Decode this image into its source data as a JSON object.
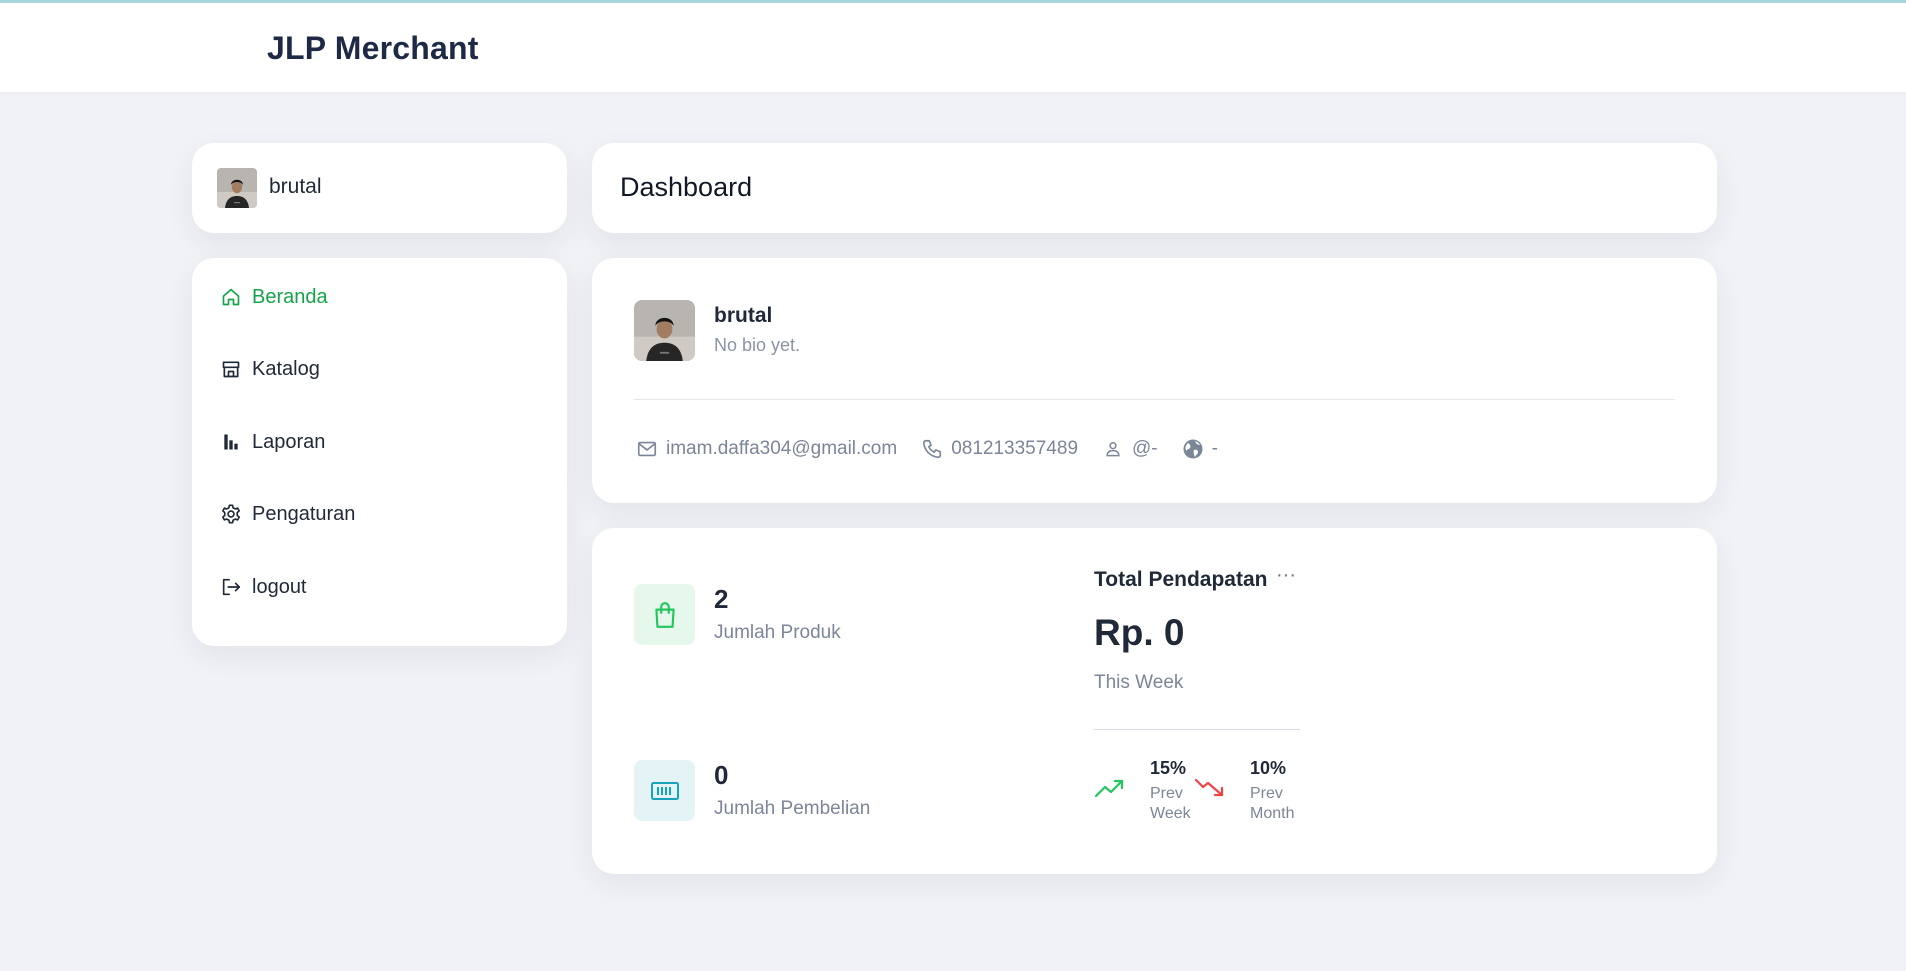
{
  "app": {
    "brand": "JLP Merchant"
  },
  "user_chip": {
    "name": "brutal"
  },
  "sidebar": {
    "items": [
      {
        "label": "Beranda",
        "icon": "home-icon",
        "active": true
      },
      {
        "label": "Katalog",
        "icon": "store-icon",
        "active": false
      },
      {
        "label": "Laporan",
        "icon": "bar-chart-icon",
        "active": false
      },
      {
        "label": "Pengaturan",
        "icon": "gear-icon",
        "active": false
      },
      {
        "label": "logout",
        "icon": "logout-icon",
        "active": false
      }
    ]
  },
  "header": {
    "title": "Dashboard"
  },
  "profile": {
    "name": "brutal",
    "bio": "No bio yet.",
    "email": "imam.daffa304@gmail.com",
    "phone": "081213357489",
    "username": "@-",
    "website": "-"
  },
  "stats": {
    "products": {
      "value": "2",
      "label": "Jumlah Produk"
    },
    "purchases": {
      "value": "0",
      "label": "Jumlah Pembelian"
    }
  },
  "income": {
    "title": "Total Pendapatan",
    "menu": "···",
    "value": "Rp. 0",
    "period": "This Week",
    "prev_week": {
      "pct": "15%",
      "label": "Prev Week"
    },
    "prev_month": {
      "pct": "10%",
      "label": "Prev Month"
    }
  },
  "colors": {
    "accent_green": "#16a34a",
    "trend_up": "#22c55e",
    "trend_down": "#ef4444",
    "product_icon_bg": "#e6f7ec",
    "purchase_icon_bg": "#e3f3f6",
    "purchase_icon": "#1aa3b8"
  }
}
